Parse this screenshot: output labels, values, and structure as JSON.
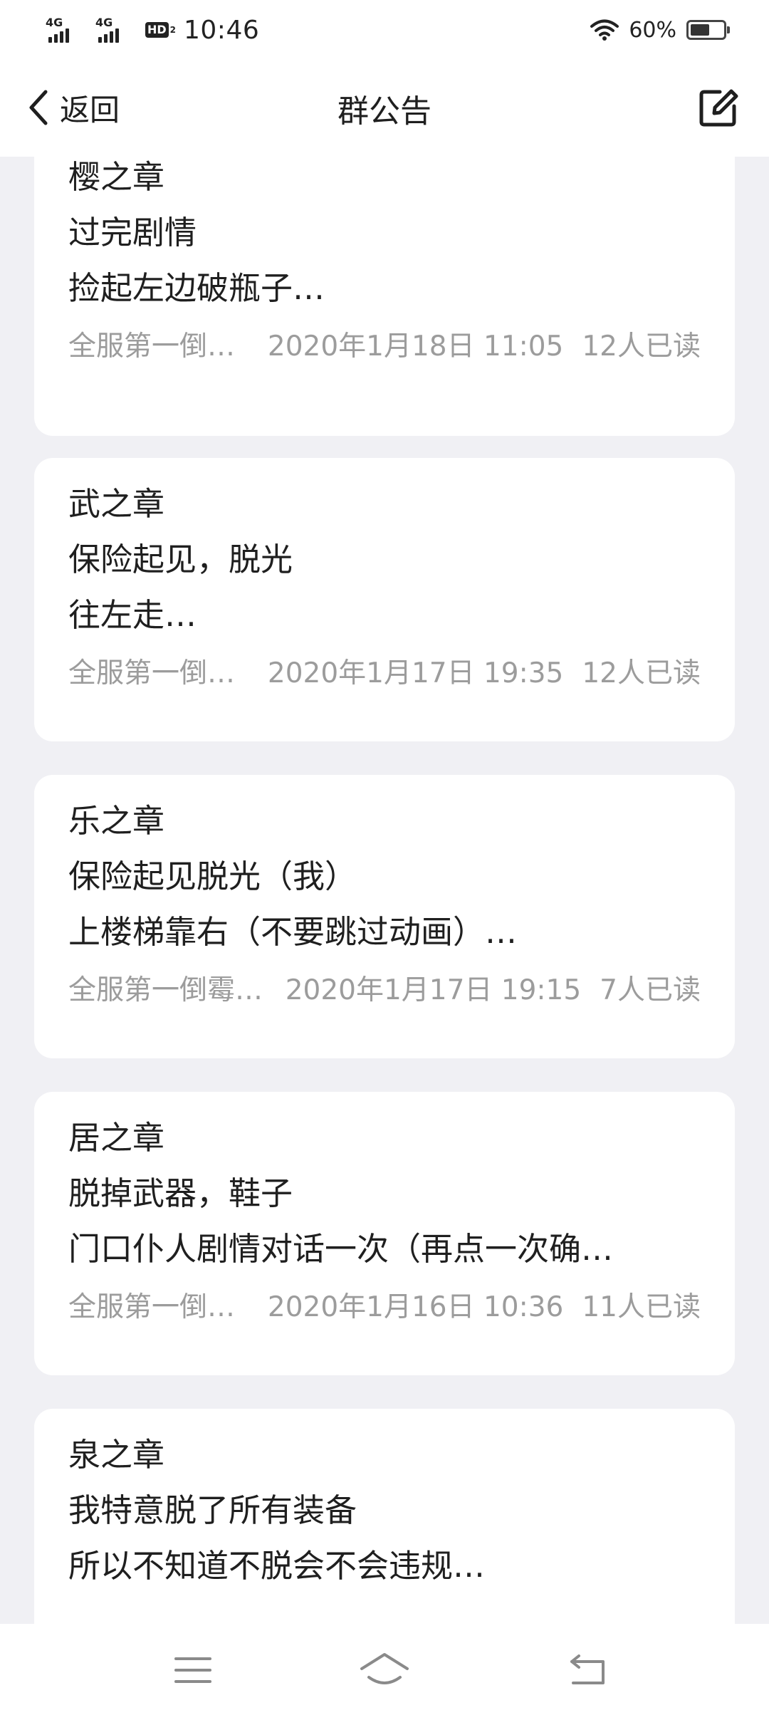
{
  "status_bar": {
    "signal_1_label": "4G",
    "signal_2_label": "4G",
    "hd_label": "HD",
    "hd_sub": "2",
    "time": "10:46",
    "battery_percent": "60%",
    "battery_level": 0.6,
    "icons": [
      "signal-icon",
      "signal-icon",
      "hd-voice-icon",
      "wifi-icon",
      "battery-icon"
    ]
  },
  "header": {
    "back_label": "返回",
    "title": "群公告",
    "icons": [
      "chevron-left-icon",
      "edit-icon"
    ]
  },
  "announcements": [
    {
      "line1": "樱之章",
      "line2": "过完剧情",
      "line3": "捡起左边破瓶子…",
      "author": "全服第一倒…",
      "date": "2020年1月18日 11:05",
      "read_count": "12人已读"
    },
    {
      "line1": "武之章",
      "line2": "保险起见，脱光",
      "line3": "往左走…",
      "author": "全服第一倒…",
      "date": "2020年1月17日 19:35",
      "read_count": "12人已读"
    },
    {
      "line1": "乐之章",
      "line2": "保险起见脱光（我）",
      "line3": "上楼梯靠右（不要跳过动画）…",
      "author": "全服第一倒霉…",
      "date": "2020年1月17日 19:15",
      "read_count": "7人已读"
    },
    {
      "line1": "居之章",
      "line2": "脱掉武器，鞋子",
      "line3": "门口仆人剧情对话一次（再点一次确…",
      "author": "全服第一倒…",
      "date": "2020年1月16日 10:36",
      "read_count": "11人已读"
    },
    {
      "line1": "泉之章",
      "line2": "我特意脱了所有装备",
      "line3": "所以不知道不脱会不会违规…"
    }
  ],
  "bottom_nav": {
    "icons": [
      "menu-icon",
      "home-icon",
      "back-icon"
    ]
  },
  "colors": {
    "background": "#f0f0f4",
    "card": "#ffffff",
    "text_primary": "#1f1f1f",
    "text_secondary": "#9c9c9c"
  }
}
